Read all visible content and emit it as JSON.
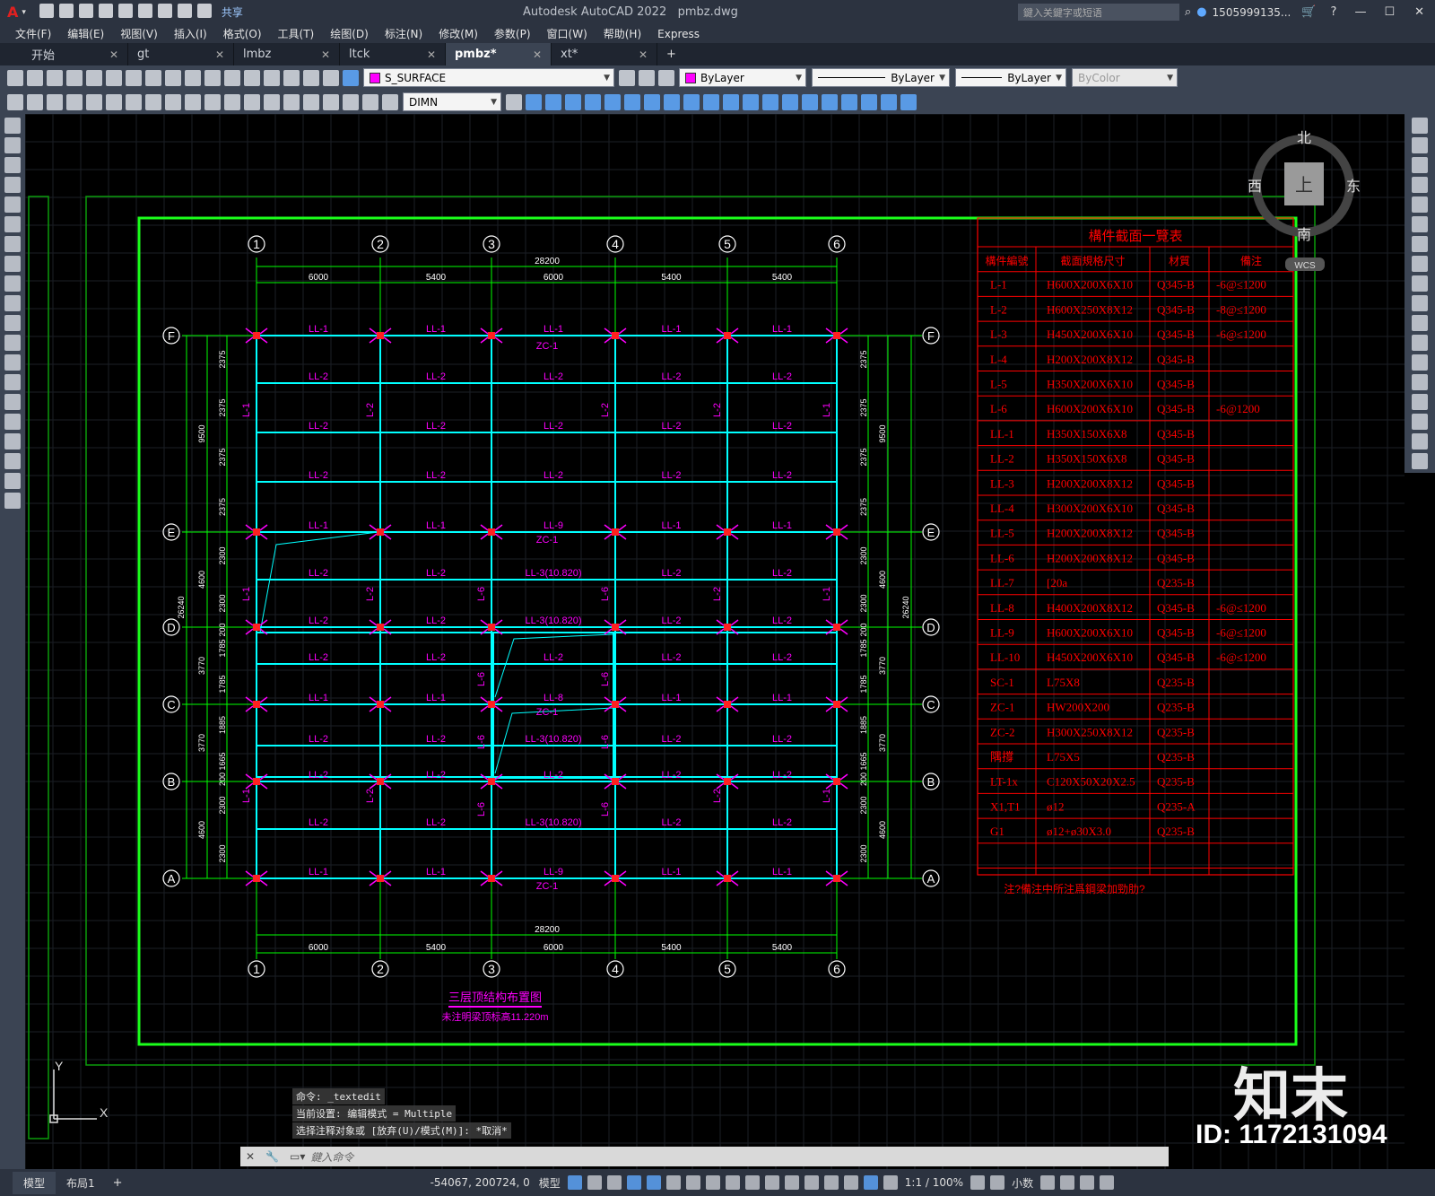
{
  "app": {
    "title": "Autodesk AutoCAD 2022",
    "file": "pmbz.dwg",
    "search_placeholder": "鍵入关鍵字或短语",
    "user": "1505999135...",
    "share": "共享"
  },
  "menu": [
    "文件(F)",
    "编辑(E)",
    "视图(V)",
    "插入(I)",
    "格式(O)",
    "工具(T)",
    "绘图(D)",
    "标注(N)",
    "修改(M)",
    "参数(P)",
    "窗口(W)",
    "帮助(H)",
    "Express"
  ],
  "tabs": [
    {
      "label": "开始"
    },
    {
      "label": "gt"
    },
    {
      "label": "lmbz"
    },
    {
      "label": "ltck"
    },
    {
      "label": "pmbz*",
      "active": true
    },
    {
      "label": "xt*"
    }
  ],
  "toolbar": {
    "layer": "S_SURFACE",
    "color": "ByLayer",
    "linetype": "ByLayer",
    "lineweight": "ByLayer",
    "plotstyle": "ByColor",
    "dimstyle": "DIMN"
  },
  "viewcube": {
    "north": "北",
    "south": "南",
    "east": "东",
    "west": "西",
    "top": "上",
    "wcs": "WCS"
  },
  "drawing": {
    "grid_cols": [
      "1",
      "2",
      "3",
      "4",
      "5",
      "6"
    ],
    "grid_rows": [
      "F",
      "E",
      "D",
      "C",
      "B",
      "A"
    ],
    "top_spans": [
      "6000",
      "5400",
      "6000",
      "5400",
      "5400"
    ],
    "total_width": "28200",
    "left_dims_outer": [
      "9500",
      "4600",
      "3770",
      "3770",
      "4600"
    ],
    "left_total": "26240",
    "right_dims_outer": [
      "9500",
      "4600",
      "3770",
      "3770",
      "4600"
    ],
    "right_total": "26240",
    "row_subdims": [
      "2375",
      "2375",
      "2375",
      "2375",
      "2300",
      "2300",
      "200",
      "1785",
      "1785",
      "1885",
      "1665",
      "200",
      "2300",
      "2300"
    ],
    "title": "三层顶结构布置图",
    "subtitle": "未注明梁顶标高11.220m",
    "beam_labels": {
      "ll1": "LL-1",
      "ll2": "LL-2",
      "ll9": "LL-9",
      "ll8": "LL-8",
      "ll3": "LL-3(10.820)",
      "zc1": "ZC-1",
      "l1": "L-1",
      "l2": "L-2",
      "l6": "L-6"
    }
  },
  "section_table": {
    "title": "構件截面一覽表",
    "headers": [
      "構件編號",
      "截面規格尺寸",
      "材質",
      "備注"
    ],
    "rows": [
      [
        "L-1",
        "H600X200X6X10",
        "Q345-B",
        "-6@≤1200"
      ],
      [
        "L-2",
        "H600X250X8X12",
        "Q345-B",
        "-8@≤1200"
      ],
      [
        "L-3",
        "H450X200X6X10",
        "Q345-B",
        "-6@≤1200"
      ],
      [
        "L-4",
        "H200X200X8X12",
        "Q345-B",
        ""
      ],
      [
        "L-5",
        "H350X200X6X10",
        "Q345-B",
        ""
      ],
      [
        "L-6",
        "H600X200X6X10",
        "Q345-B",
        "-6@1200"
      ],
      [
        "LL-1",
        "H350X150X6X8",
        "Q345-B",
        ""
      ],
      [
        "LL-2",
        "H350X150X6X8",
        "Q345-B",
        ""
      ],
      [
        "LL-3",
        "H200X200X8X12",
        "Q345-B",
        ""
      ],
      [
        "LL-4",
        "H300X200X6X10",
        "Q345-B",
        ""
      ],
      [
        "LL-5",
        "H200X200X8X12",
        "Q345-B",
        ""
      ],
      [
        "LL-6",
        "H200X200X8X12",
        "Q345-B",
        ""
      ],
      [
        "LL-7",
        "[20a",
        "Q235-B",
        ""
      ],
      [
        "LL-8",
        "H400X200X8X12",
        "Q345-B",
        "-6@≤1200"
      ],
      [
        "LL-9",
        "H600X200X6X10",
        "Q345-B",
        "-6@≤1200"
      ],
      [
        "LL-10",
        "H450X200X6X10",
        "Q345-B",
        "-6@≤1200"
      ],
      [
        "SC-1",
        "L75X8",
        "Q235-B",
        ""
      ],
      [
        "ZC-1",
        "HW200X200",
        "Q235-B",
        ""
      ],
      [
        "ZC-2",
        "H300X250X8X12",
        "Q235-B",
        ""
      ],
      [
        "隅撐",
        "L75X5",
        "Q235-B",
        ""
      ],
      [
        "LT-1x",
        "C120X50X20X2.5",
        "Q235-B",
        ""
      ],
      [
        "X1,T1",
        "ø12",
        "Q235-A",
        ""
      ],
      [
        "G1",
        "ø12+ø30X3.0",
        "Q235-B",
        ""
      ]
    ],
    "note": "注?備注中所注爲鋼梁加勁肋?"
  },
  "command_history": [
    "命令: _textedit",
    "当前设置: 编辑模式 = Multiple",
    "选择注释对象或 [放弃(U)/模式(M)]: *取消*"
  ],
  "command_placeholder": "鍵入命令",
  "layout_tabs": [
    "模型",
    "布局1"
  ],
  "status": {
    "coords": "-54067, 200724, 0",
    "space": "模型",
    "scale": "1:1 / 100%",
    "units": "小数"
  },
  "watermark": {
    "brand": "知末",
    "id": "ID: 1172131094"
  },
  "colors": {
    "grid_line": "#00ff00",
    "column_line": "#00ffff",
    "label": "#ff00ff",
    "table": "#ff0000",
    "dim": "#00ff00"
  }
}
